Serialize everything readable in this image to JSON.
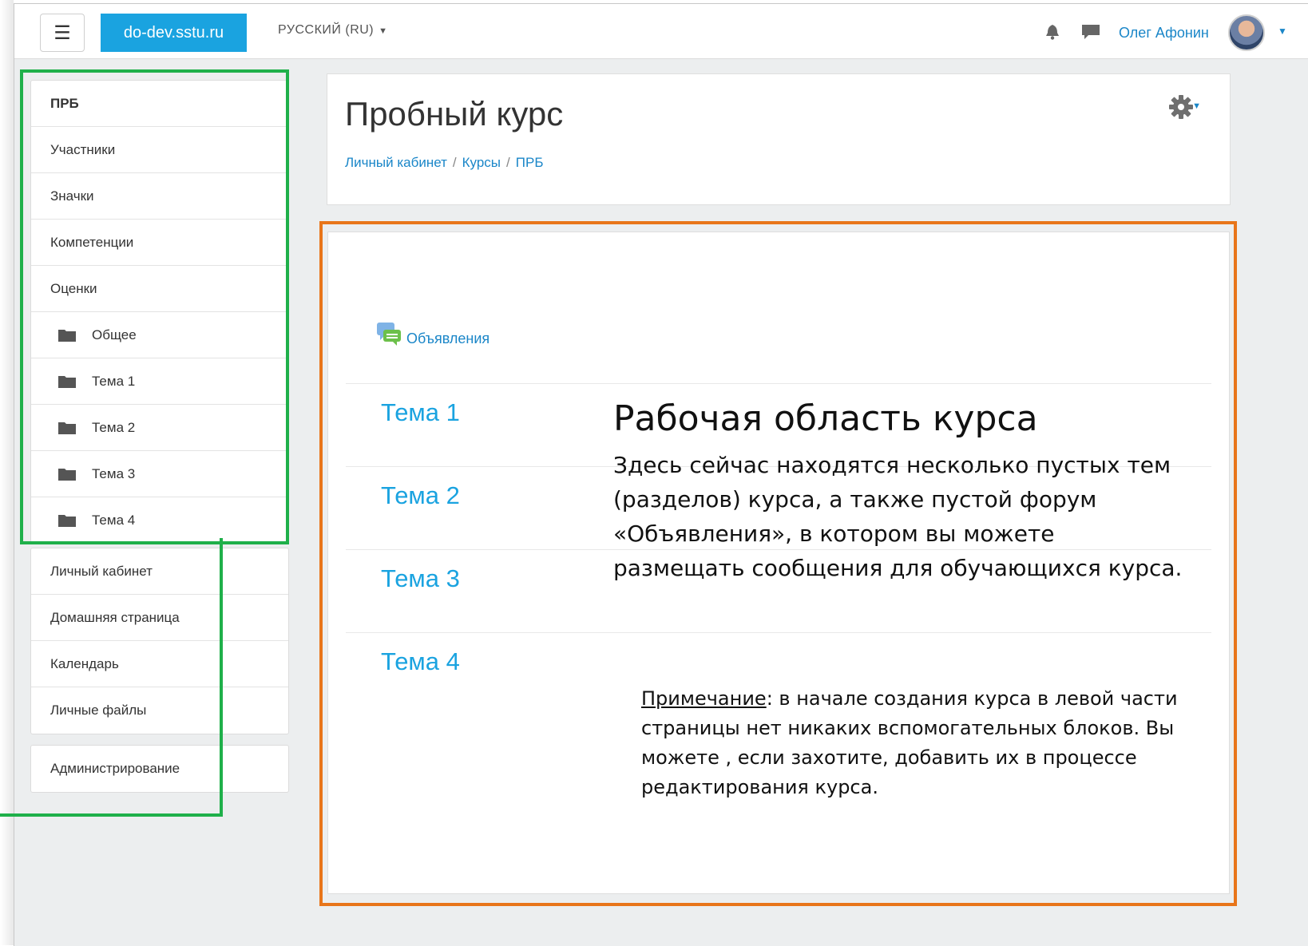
{
  "navbar": {
    "menu_icon": "hamburger-icon",
    "brand": "do-dev.sstu.ru",
    "language": "РУССКИЙ (RU)",
    "notifications_icon": "bell-icon",
    "messages_icon": "chat-icon",
    "user_name": "Олег Афонин",
    "user_menu_icon": "chevron-down-icon"
  },
  "sidebar": {
    "course_nav": [
      {
        "label": "ПРБ"
      },
      {
        "label": "Участники"
      },
      {
        "label": "Значки"
      },
      {
        "label": "Компетенции"
      },
      {
        "label": "Оценки"
      },
      {
        "label": "Общее",
        "icon": "folder-icon"
      },
      {
        "label": "Тема 1",
        "icon": "folder-icon"
      },
      {
        "label": "Тема 2",
        "icon": "folder-icon"
      },
      {
        "label": "Тема 3",
        "icon": "folder-icon"
      },
      {
        "label": "Тема 4",
        "icon": "folder-icon"
      }
    ],
    "site_nav": [
      {
        "label": "Личный кабинет"
      },
      {
        "label": "Домашняя страница"
      },
      {
        "label": "Календарь"
      },
      {
        "label": "Личные файлы"
      }
    ],
    "admin": {
      "label": "Администрирование"
    }
  },
  "header": {
    "title": "Пробный курс",
    "breadcrumb": [
      "Личный кабинет",
      "Курсы",
      "ПРБ"
    ],
    "breadcrumb_sep": "/",
    "settings_icon": "gear-icon"
  },
  "main": {
    "forum": {
      "label": "Объявления",
      "icon": "forum-icon"
    },
    "topics": [
      "Тема 1",
      "Тема 2",
      "Тема 3",
      "Тема 4"
    ]
  },
  "annotation": {
    "title": "Рабочая область курса",
    "body": "Здесь сейчас находятся несколько пустых тем (разделов) курса,  а также пустой форум «Объявления», в котором вы можете размещать сообщения для обучающихся курса.",
    "note_label": "Примечание",
    "note_text": ": в начале создания курса в левой части страницы нет никаких вспомогательных блоков. Вы можете , если захотите, добавить их в процессе редактирования курса."
  },
  "colors": {
    "brand": "#1aa3e0",
    "link": "#1a86c8",
    "highlight_green": "#1fb04a",
    "highlight_orange": "#e8751a"
  }
}
